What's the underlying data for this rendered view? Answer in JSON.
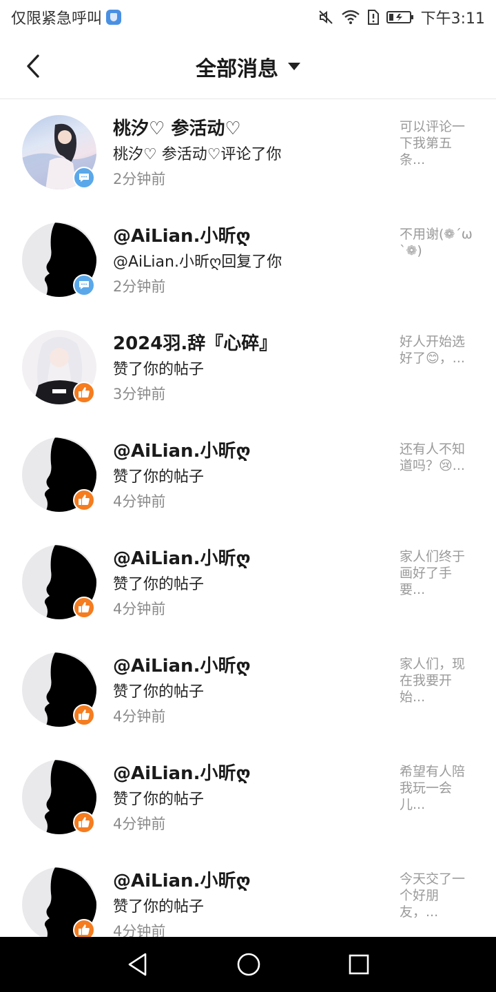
{
  "status_bar": {
    "carrier": "仅限紧急呼叫",
    "time": "下午3:11",
    "icons": [
      "shield-icon",
      "mute-icon",
      "wifi-icon",
      "sim-alert-icon",
      "battery-icon"
    ]
  },
  "header": {
    "title": "全部消息",
    "back_icon": "back-arrow-icon",
    "dropdown_icon": "caret-down-icon"
  },
  "colors": {
    "comment_badge": "#5aa8ea",
    "like_badge": "#f57c1f",
    "time_text": "#8a8a8a",
    "preview_text": "#9a9a9a"
  },
  "messages": [
    {
      "name": "桃汐♡ 参活动♡",
      "action": "桃汐♡ 参活动♡评论了你",
      "time": "2分钟前",
      "preview": "可以评论一下我第五条...",
      "badge": "comment-icon"
    },
    {
      "name": "@AiLian.小昕ღ",
      "action": "@AiLian.小昕ღ回复了你",
      "time": "2分钟前",
      "preview": "不用谢(❁´ω`❁)",
      "badge": "comment-icon"
    },
    {
      "name": "2024羽.辞『心碎』",
      "action": "赞了你的帖子",
      "time": "3分钟前",
      "preview": "好人开始选好了😊，...",
      "badge": "thumbs-up-icon"
    },
    {
      "name": "@AiLian.小昕ღ",
      "action": "赞了你的帖子",
      "time": "4分钟前",
      "preview": "还有人不知道吗？😢...",
      "badge": "thumbs-up-icon"
    },
    {
      "name": "@AiLian.小昕ღ",
      "action": "赞了你的帖子",
      "time": "4分钟前",
      "preview": "家人们终于画好了手要...",
      "badge": "thumbs-up-icon"
    },
    {
      "name": "@AiLian.小昕ღ",
      "action": "赞了你的帖子",
      "time": "4分钟前",
      "preview": "家人们，现在我要开始...",
      "badge": "thumbs-up-icon"
    },
    {
      "name": "@AiLian.小昕ღ",
      "action": "赞了你的帖子",
      "time": "4分钟前",
      "preview": "希望有人陪我玩一会儿...",
      "badge": "thumbs-up-icon"
    },
    {
      "name": "@AiLian.小昕ღ",
      "action": "赞了你的帖子",
      "time": "4分钟前",
      "preview": "今天交了一个好朋友，...",
      "badge": "thumbs-up-icon"
    }
  ],
  "nav_bar": {
    "icons": [
      "nav-back-icon",
      "nav-home-icon",
      "nav-recents-icon"
    ]
  }
}
